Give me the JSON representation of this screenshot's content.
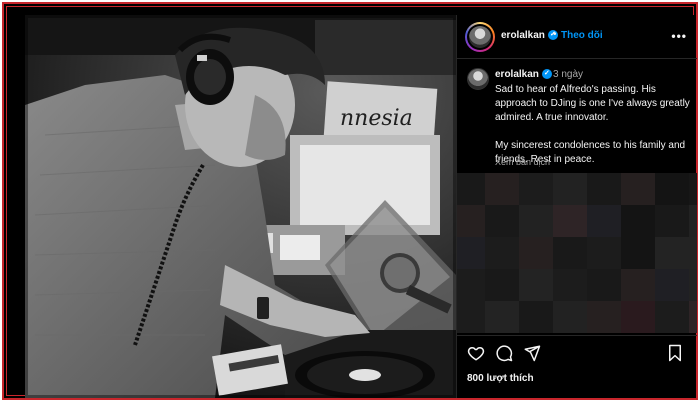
{
  "header": {
    "username": "erolalkan",
    "separator": "•",
    "follow_label": "Theo dõi",
    "more_label": "•••"
  },
  "comment": {
    "username": "erolalkan",
    "time": "3 ngày",
    "paragraph1": "Sad to hear of Alfredo's passing. His approach to DJing is one I've always greatly admired. A true innovator.",
    "paragraph2": "My sincerest condolences to his family and friends. Rest in peace.",
    "translate_label": "Xem bản dịch"
  },
  "photo": {
    "sign_text": "nnesia"
  },
  "actions": {
    "likes": "800 lượt thích",
    "icons": [
      "heart-icon",
      "comment-icon",
      "share-icon",
      "bookmark-icon"
    ]
  },
  "colors": {
    "frame_red": "#c8262c",
    "link_blue": "#0095f6",
    "background": "#000000",
    "text": "#f5f5f5",
    "muted": "#a8a8a8"
  }
}
